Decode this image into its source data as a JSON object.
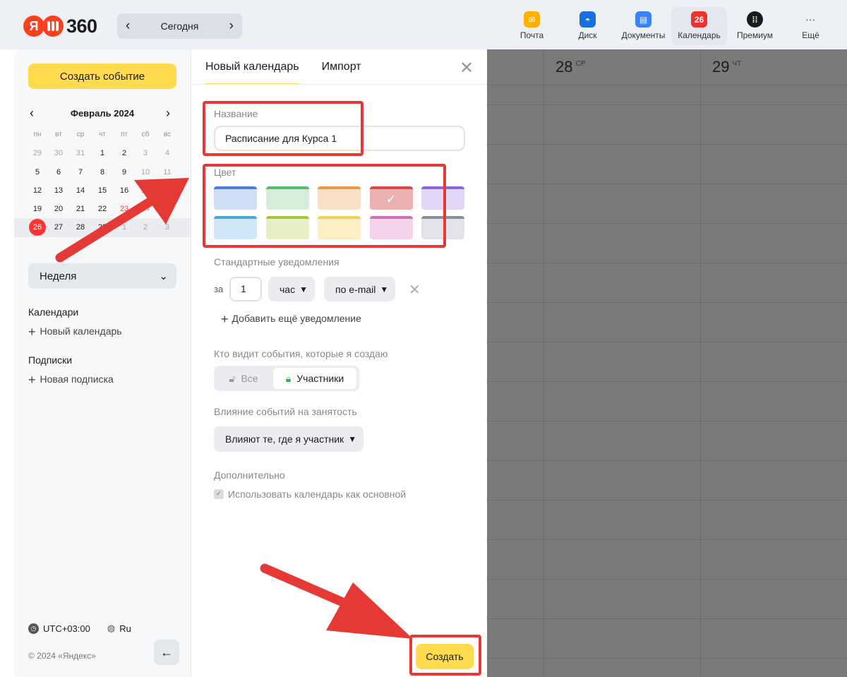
{
  "topbar": {
    "logo_mark": "Я",
    "logo_text": "360",
    "today_label": "Сегодня",
    "apps": [
      {
        "label": "Почта",
        "icon": "mail-icon",
        "color": "#ffb000",
        "badge": ""
      },
      {
        "label": "Диск",
        "icon": "disk-icon",
        "color": "#1a6fe0",
        "badge": ""
      },
      {
        "label": "Документы",
        "icon": "documents-icon",
        "color": "#3b82f6",
        "badge": ""
      },
      {
        "label": "Календарь",
        "icon": "calendar-icon",
        "color": "#f0322d",
        "badge": "26"
      },
      {
        "label": "Премиум",
        "icon": "premium-icon",
        "color": "#1a1a1a",
        "badge": ""
      },
      {
        "label": "Ещё",
        "icon": "more-icon",
        "color": "transparent",
        "badge": "···"
      }
    ]
  },
  "sidebar": {
    "create_label": "Создать событие",
    "month_title": "Февраль 2024",
    "weekdays": [
      "пн",
      "вт",
      "ср",
      "чт",
      "пт",
      "сб",
      "вс"
    ],
    "weeks": [
      [
        "29",
        "30",
        "31",
        "1",
        "2",
        "3",
        "4"
      ],
      [
        "5",
        "6",
        "7",
        "8",
        "9",
        "10",
        "11"
      ],
      [
        "12",
        "13",
        "14",
        "15",
        "16",
        "17",
        "18"
      ],
      [
        "19",
        "20",
        "21",
        "22",
        "23",
        "24",
        "25"
      ],
      [
        "26",
        "27",
        "28",
        "29",
        "1",
        "2",
        "3"
      ]
    ],
    "view_label": "Неделя",
    "calendars_title": "Календари",
    "new_calendar_label": "Новый календарь",
    "subscriptions_title": "Подписки",
    "new_subscription_label": "Новая подписка",
    "timezone": "UTC+03:00",
    "language": "Ru",
    "copyright": "© 2024 «Яндекс»"
  },
  "panel": {
    "tab_new": "Новый календарь",
    "tab_import": "Импорт",
    "name_label": "Название",
    "name_value": "Расписание для Курса 1",
    "color_label": "Цвет",
    "colors": [
      {
        "top": "#4a7fd6",
        "fill": "#cfdcf6",
        "selected": false
      },
      {
        "top": "#5cb96e",
        "fill": "#d5ecd9",
        "selected": false
      },
      {
        "top": "#e99a3c",
        "fill": "#f8e0c5",
        "selected": false
      },
      {
        "top": "#d64a4a",
        "fill": "#ebb0b0",
        "selected": true
      },
      {
        "top": "#9063e0",
        "fill": "#e2d7f7",
        "selected": false
      },
      {
        "top": "#4aa6d9",
        "fill": "#cfe6f6",
        "selected": false
      },
      {
        "top": "#a8c23a",
        "fill": "#e7f0c4",
        "selected": false
      },
      {
        "top": "#f2cf58",
        "fill": "#fbefc3",
        "selected": false
      },
      {
        "top": "#d36db0",
        "fill": "#f3d3e9",
        "selected": false
      },
      {
        "top": "#8a8fa0",
        "fill": "#e2e3e8",
        "selected": false
      }
    ],
    "notifications_label": "Стандартные уведомления",
    "notif_prefix": "за",
    "notif_amount": "1",
    "notif_unit": "час",
    "notif_channel": "по e-mail",
    "add_notification": "Добавить ещё уведомление",
    "visibility_label": "Кто видит события, которые я создаю",
    "visibility_all": "Все",
    "visibility_participants": "Участники",
    "busy_label": "Влияние событий на занятость",
    "busy_value": "Влияют те, где я участник",
    "extra_label": "Дополнительно",
    "primary_checkbox": "Использовать календарь как основной",
    "submit_label": "Создать"
  },
  "grid": {
    "days": [
      {
        "num": "28",
        "dow": "СР"
      },
      {
        "num": "29",
        "dow": "ЧТ"
      }
    ]
  },
  "annotations": {
    "color": "#e53935"
  }
}
